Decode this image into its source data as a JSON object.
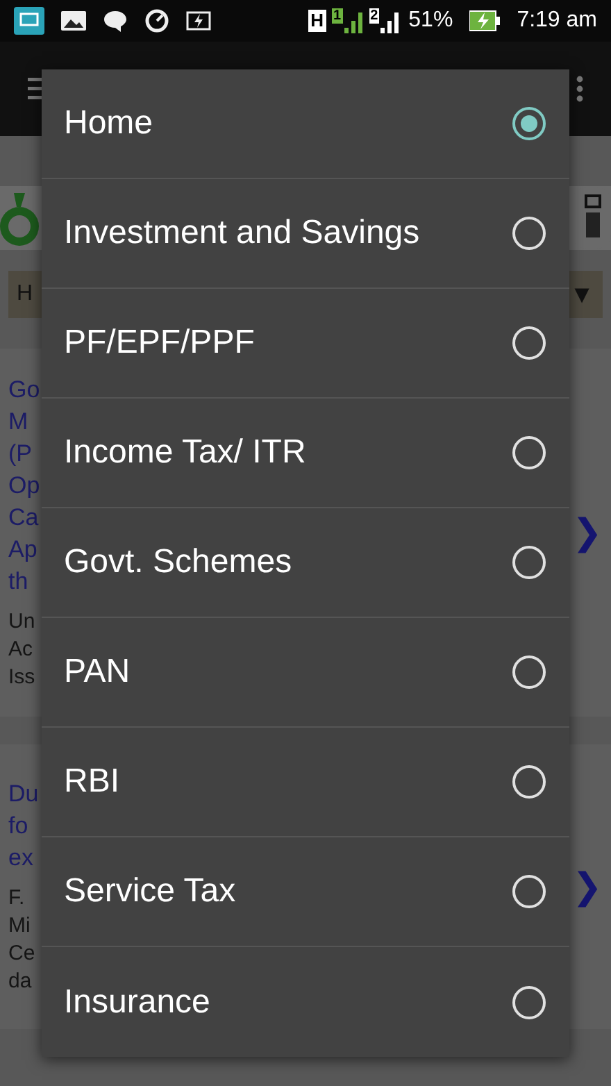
{
  "status_bar": {
    "network_type": "H",
    "sim_1": "1",
    "sim_2": "2",
    "battery": "51%",
    "time": "7:19 am"
  },
  "background": {
    "tab_label": "H",
    "tab_arrow": "▼",
    "articles": [
      {
        "title_lines": [
          "Go",
          "M",
          "(P",
          "Op",
          "Ca",
          "Ap",
          "th"
        ],
        "summary_lines": [
          "Un",
          "Ac",
          "Iss"
        ],
        "arrow": "❯"
      },
      {
        "title_lines": [
          "Du",
          "fo",
          "ex"
        ],
        "summary_lines": [
          "F.",
          "Mi",
          "Ce",
          "da"
        ],
        "arrow": "❯"
      }
    ]
  },
  "menu": {
    "items": [
      {
        "label": "Home",
        "selected": true
      },
      {
        "label": "Investment and Savings",
        "selected": false
      },
      {
        "label": "PF/EPF/PPF",
        "selected": false
      },
      {
        "label": "Income Tax/ ITR",
        "selected": false
      },
      {
        "label": "Govt. Schemes",
        "selected": false
      },
      {
        "label": "PAN",
        "selected": false
      },
      {
        "label": "RBI",
        "selected": false
      },
      {
        "label": "Service Tax",
        "selected": false
      },
      {
        "label": "Insurance",
        "selected": false
      }
    ]
  }
}
